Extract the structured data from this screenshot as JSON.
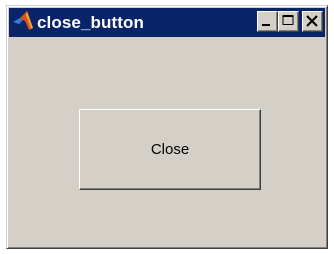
{
  "window": {
    "title": "close_button",
    "icon": "matlab-logo-icon"
  },
  "caption_buttons": [
    {
      "name": "minimize-button",
      "icon": "minimize-icon"
    },
    {
      "name": "maximize-button",
      "icon": "maximize-icon"
    },
    {
      "name": "close-window-button",
      "icon": "close-icon"
    }
  ],
  "main": {
    "close_button_label": "Close"
  },
  "colors": {
    "titlebar": "#0a246a",
    "window_face": "#d4d0c8"
  }
}
